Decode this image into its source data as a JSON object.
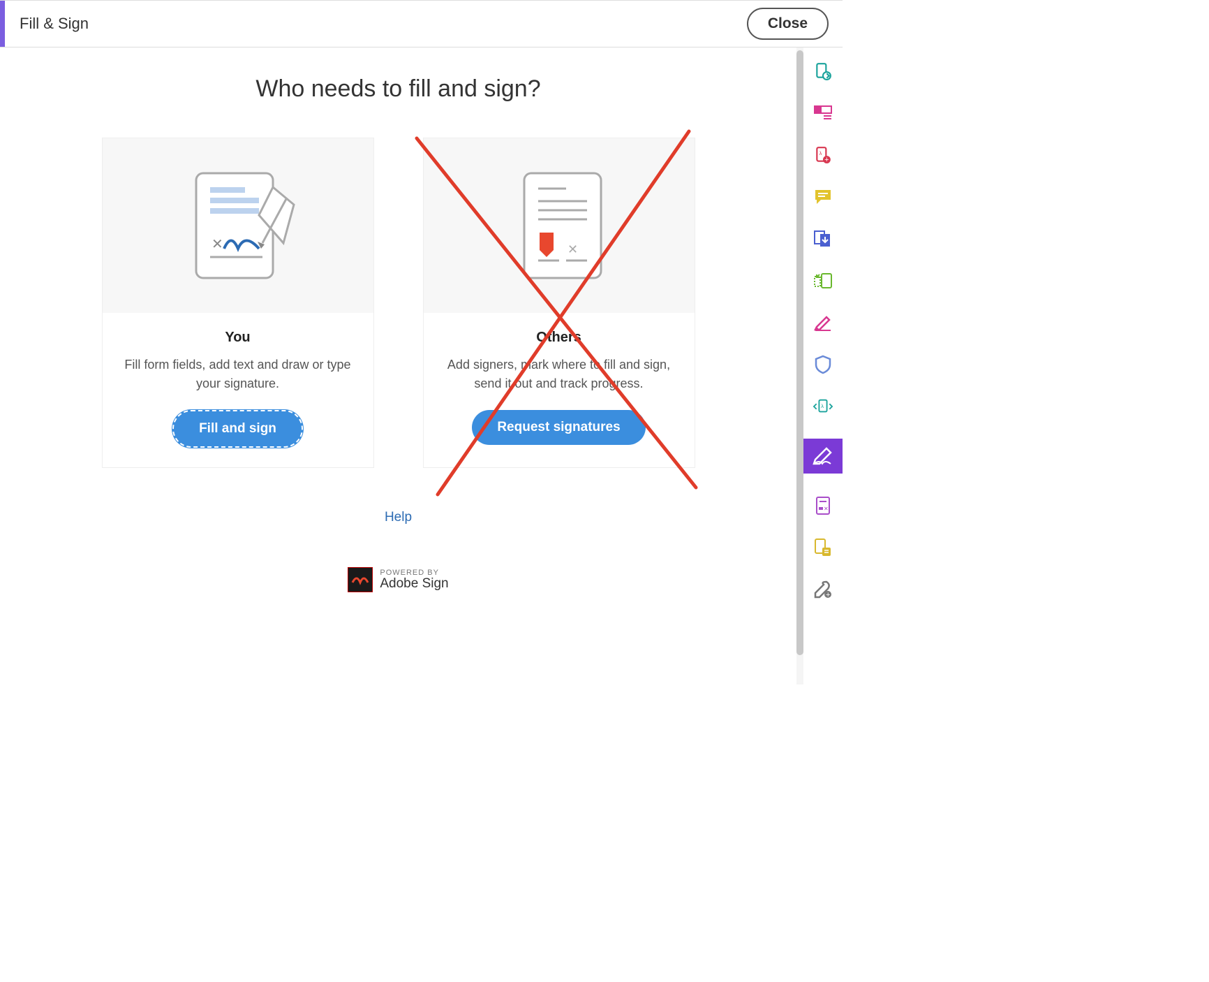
{
  "header": {
    "title": "Fill & Sign",
    "close_label": "Close"
  },
  "main": {
    "heading": "Who needs to fill and sign?",
    "cards": [
      {
        "title": "You",
        "desc": "Fill form fields, add text and draw or type your signature.",
        "button": "Fill and sign"
      },
      {
        "title": "Others",
        "desc": "Add signers, mark where to fill and sign, send it out and track progress.",
        "button": "Request signatures"
      }
    ],
    "help_label": "Help"
  },
  "footer": {
    "powered_label": "POWERED BY",
    "brand": "Adobe Sign"
  },
  "sidebar": {
    "icons": [
      "export-pdf-icon",
      "layout-icon",
      "create-pdf-icon",
      "comment-icon",
      "share-download-icon",
      "device-icon",
      "edit-pen-icon",
      "shield-icon",
      "page-handle-icon",
      "fill-sign-icon",
      "redact-icon",
      "compare-icon",
      "tools-icon"
    ]
  },
  "annotation": {
    "type": "red-cross",
    "target": "others-card",
    "color": "#e03c2a"
  }
}
